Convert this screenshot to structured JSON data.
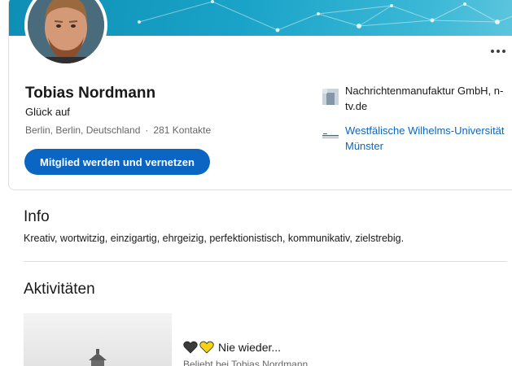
{
  "profile": {
    "name": "Tobias Nordmann",
    "headline": "Glück auf",
    "location": "Berlin, Berlin, Deutschland",
    "separator": "·",
    "connections": "281 Kontakte",
    "join_button": "Mitglied werden und vernetzen"
  },
  "organizations": [
    {
      "name": "Nachrichtenmanufaktur GmbH, n-tv.de",
      "icon": "company-logo-icon"
    },
    {
      "name": "Westfälische Wilhelms-Universität Münster",
      "icon": "university-logo-icon"
    }
  ],
  "info": {
    "title": "Info",
    "text": "Kreativ, wortwitzig, einzigartig, ehrgeizig, perfektionistisch, kommunikativ, zielstrebig."
  },
  "activities": {
    "title": "Aktivitäten",
    "items": [
      {
        "post_title": "Nie wieder...",
        "liked_by": "Beliebt bei Tobias Nordmann",
        "reactions": [
          "black-heart-icon",
          "yellow-heart-icon"
        ]
      }
    ]
  },
  "colors": {
    "accent": "#0a66c2",
    "banner": "#1aa3c8",
    "muted_text": "#666666"
  }
}
